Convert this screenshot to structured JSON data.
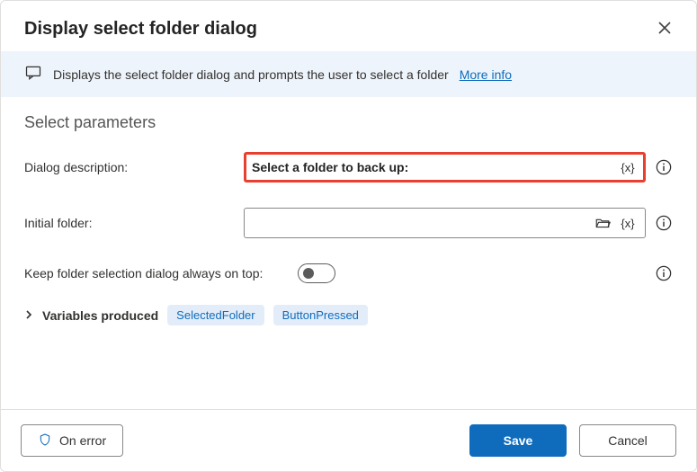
{
  "header": {
    "title": "Display select folder dialog"
  },
  "banner": {
    "text": "Displays the select folder dialog and prompts the user to select a folder",
    "more_info": "More info"
  },
  "section_title": "Select parameters",
  "fields": {
    "description": {
      "label": "Dialog description:",
      "value": "Select a folder to back up:"
    },
    "initial_folder": {
      "label": "Initial folder:",
      "value": ""
    },
    "always_on_top": {
      "label": "Keep folder selection dialog always on top:",
      "value": false
    }
  },
  "variables": {
    "label": "Variables produced",
    "items": [
      "SelectedFolder",
      "ButtonPressed"
    ]
  },
  "footer": {
    "on_error": "On error",
    "save": "Save",
    "cancel": "Cancel"
  },
  "glyphs": {
    "var_token": "{x}"
  }
}
